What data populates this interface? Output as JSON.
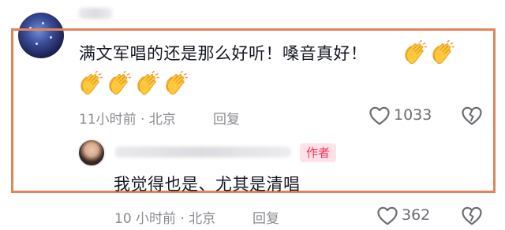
{
  "comment": {
    "text": "满文军唱的还是那么好听！嗓音真好！",
    "emoji_icon": "clapping-hands-emoji",
    "time_location": "11小时前 · 北京",
    "reply_label": "回复",
    "like_count": "1033"
  },
  "reply": {
    "author_badge": "作者",
    "text": "我觉得也是、尤其是清唱",
    "time_location": "10 小时前 · 北京",
    "reply_label": "回复",
    "like_count": "362"
  },
  "colors": {
    "highlight_frame": "#e4835a",
    "author_badge_text": "#fe2c55",
    "author_badge_bg": "#fde3e8",
    "meta_text": "#8a8b91"
  }
}
